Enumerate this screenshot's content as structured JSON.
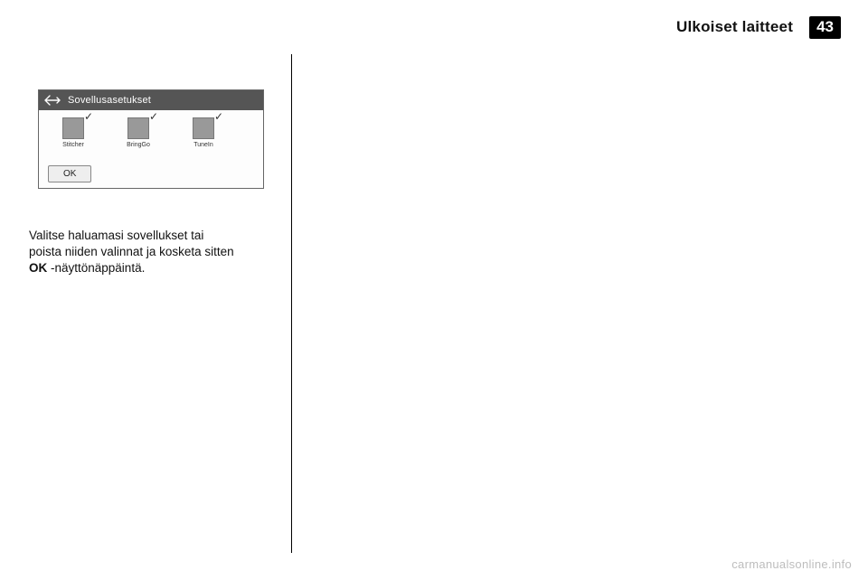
{
  "header": {
    "section_title": "Ulkoiset laitteet",
    "page_number": "43"
  },
  "device": {
    "title": "Sovellusasetukset",
    "apps": [
      {
        "label": "Stitcher"
      },
      {
        "label": "BringGo"
      },
      {
        "label": "TuneIn"
      }
    ],
    "ok_label": "OK"
  },
  "body": {
    "line1": "Valitse haluamasi sovellukset tai",
    "line2": "poista niiden valinnat ja kosketa sitten",
    "line3_prefix": "OK",
    "line3_suffix": " ‑näyttönäppäintä."
  },
  "watermark": "carmanualsonline.info"
}
